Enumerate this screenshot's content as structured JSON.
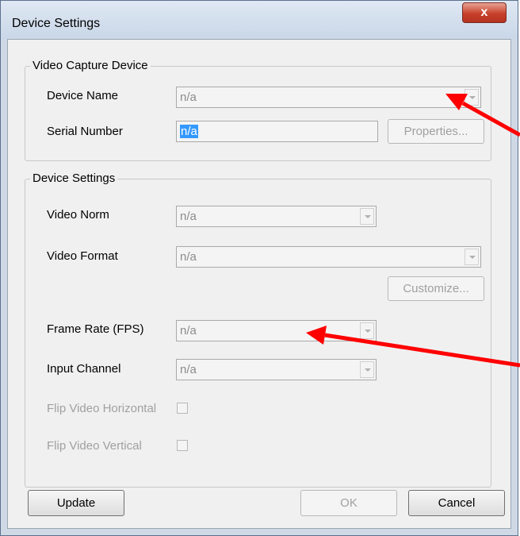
{
  "window": {
    "title": "Device Settings",
    "close_glyph": "x"
  },
  "capture_group": {
    "legend": "Video Capture Device",
    "device_name_label": "Device Name",
    "device_name_value": "n/a",
    "serial_number_label": "Serial Number",
    "serial_number_value": "n/a",
    "properties_button": "Properties..."
  },
  "settings_group": {
    "legend": "Device Settings",
    "video_norm_label": "Video Norm",
    "video_norm_value": "n/a",
    "video_format_label": "Video Format",
    "video_format_value": "n/a",
    "customize_button": "Customize...",
    "frame_rate_label": "Frame Rate (FPS)",
    "frame_rate_value": "n/a",
    "input_channel_label": "Input Channel",
    "input_channel_value": "n/a",
    "flip_horizontal_label": "Flip Video Horizontal",
    "flip_vertical_label": "Flip Video Vertical"
  },
  "footer": {
    "update_button": "Update",
    "ok_button": "OK",
    "cancel_button": "Cancel"
  },
  "annotation": {
    "arrow_color": "#ff0000"
  }
}
